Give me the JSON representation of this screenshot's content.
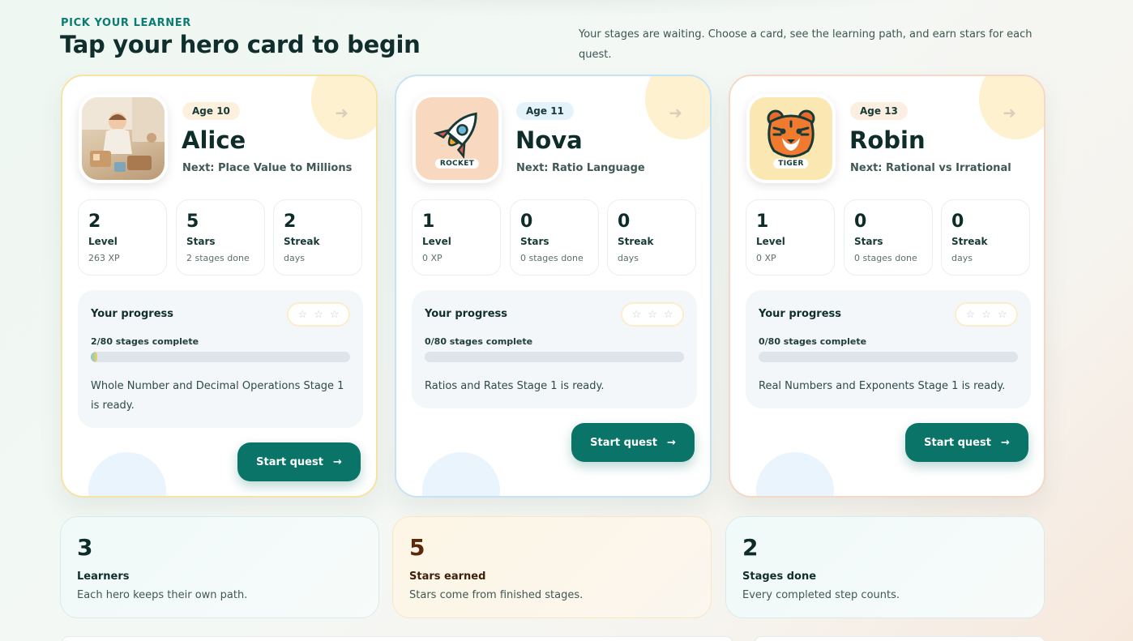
{
  "header": {
    "eyebrow": "PICK YOUR LEARNER",
    "title": "Tap your hero card to begin",
    "intro": "Your stages are waiting. Choose a card, see the learning path, and earn stars for each quest."
  },
  "learners": [
    {
      "name": "Alice",
      "age": "Age 10",
      "next": "Next: Place Value to Millions",
      "avatar": "photo",
      "stats": [
        {
          "value": "2",
          "label": "Level",
          "sub": "263 XP"
        },
        {
          "value": "5",
          "label": "Stars",
          "sub": "2 stages done"
        },
        {
          "value": "2",
          "label": "Streak",
          "sub": "days"
        }
      ],
      "progress": {
        "title": "Your progress",
        "count": "2/80 stages complete",
        "fraction": 0.025,
        "message": "Whole Number and Decimal Operations Stage 1 is ready."
      },
      "button": "Start quest"
    },
    {
      "name": "Nova",
      "age": "Age 11",
      "next": "Next: Ratio Language",
      "avatar": "rocket",
      "avatar_tag": "ROCKET",
      "stats": [
        {
          "value": "1",
          "label": "Level",
          "sub": "0 XP"
        },
        {
          "value": "0",
          "label": "Stars",
          "sub": "0 stages done"
        },
        {
          "value": "0",
          "label": "Streak",
          "sub": "days"
        }
      ],
      "progress": {
        "title": "Your progress",
        "count": "0/80 stages complete",
        "fraction": 0,
        "message": "Ratios and Rates Stage 1 is ready."
      },
      "button": "Start quest"
    },
    {
      "name": "Robin",
      "age": "Age 13",
      "next": "Next: Rational vs Irrational",
      "avatar": "tiger",
      "avatar_tag": "TIGER",
      "stats": [
        {
          "value": "1",
          "label": "Level",
          "sub": "0 XP"
        },
        {
          "value": "0",
          "label": "Stars",
          "sub": "0 stages done"
        },
        {
          "value": "0",
          "label": "Streak",
          "sub": "days"
        }
      ],
      "progress": {
        "title": "Your progress",
        "count": "0/80 stages complete",
        "fraction": 0,
        "message": "Real Numbers and Exponents Stage 1 is ready."
      },
      "button": "Start quest"
    }
  ],
  "summary": [
    {
      "value": "3",
      "label": "Learners",
      "desc": "Each hero keeps their own path."
    },
    {
      "value": "5",
      "label": "Stars earned",
      "desc": "Stars come from finished stages."
    },
    {
      "value": "2",
      "label": "Stages done",
      "desc": "Every completed step counts."
    }
  ],
  "icons": {
    "star": "star-outline-icon",
    "arrow": "arrow-right-icon"
  },
  "colors": {
    "accent": "#0b7468",
    "eyebrow": "#0c7c72"
  }
}
